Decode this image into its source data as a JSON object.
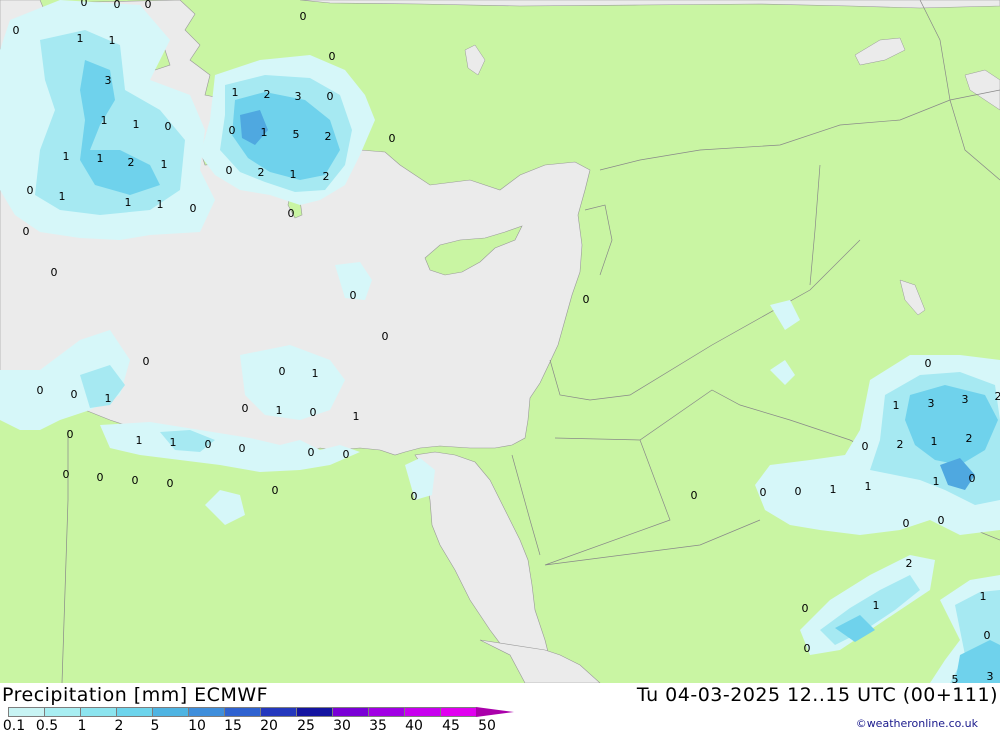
{
  "map": {
    "colors": {
      "land": "#c9f5a3",
      "sea": "#ebebeb",
      "border": "#888888",
      "precip_light": "#d6f7f9",
      "precip_medium": "#a6e9f2",
      "precip_heavy": "#6fd2ec",
      "precip_strong": "#4fa8e0"
    },
    "values": [
      "0",
      "0",
      "0",
      "0",
      "1",
      "1",
      "3",
      "1",
      "1",
      "0",
      "1",
      "1",
      "2",
      "1",
      "0",
      "1",
      "1",
      "1",
      "0",
      "0",
      "0",
      "1",
      "2",
      "3",
      "0",
      "0",
      "1",
      "5",
      "2",
      "0",
      "2",
      "1",
      "2",
      "0",
      "0",
      "0",
      "0",
      "0",
      "0",
      "0",
      "0",
      "1",
      "0",
      "1",
      "0",
      "0",
      "0",
      "1",
      "0",
      "1",
      "0",
      "1",
      "1",
      "0",
      "0",
      "0",
      "0",
      "0",
      "0",
      "0",
      "0",
      "0",
      "0",
      "0",
      "1",
      "3",
      "3",
      "2",
      "0",
      "2",
      "1",
      "2",
      "1",
      "0",
      "0",
      "1",
      "1",
      "0",
      "0",
      "0",
      "0",
      "2",
      "1",
      "1",
      "0",
      "0",
      "0",
      "5",
      "3"
    ]
  },
  "footer": {
    "title_left": "Precipitation [mm] ECMWF",
    "title_right": "Tu 04-03-2025 12..15 UTC (00+111)",
    "legend": {
      "labels": [
        "0.1",
        "0.5",
        "1",
        "2",
        "5",
        "10",
        "15",
        "20",
        "25",
        "30",
        "35",
        "40",
        "45",
        "50"
      ],
      "colors": [
        "#c8f4f4",
        "#a8eef2",
        "#8ce4ef",
        "#6dd4ec",
        "#4fb4e2",
        "#3f8edb",
        "#2f62d0",
        "#2438bd",
        "#1414a0",
        "#7a00d6",
        "#a100e4",
        "#c800ef",
        "#e100f0",
        "#b000b8"
      ]
    },
    "credit": "©weatheronline.co.uk"
  }
}
